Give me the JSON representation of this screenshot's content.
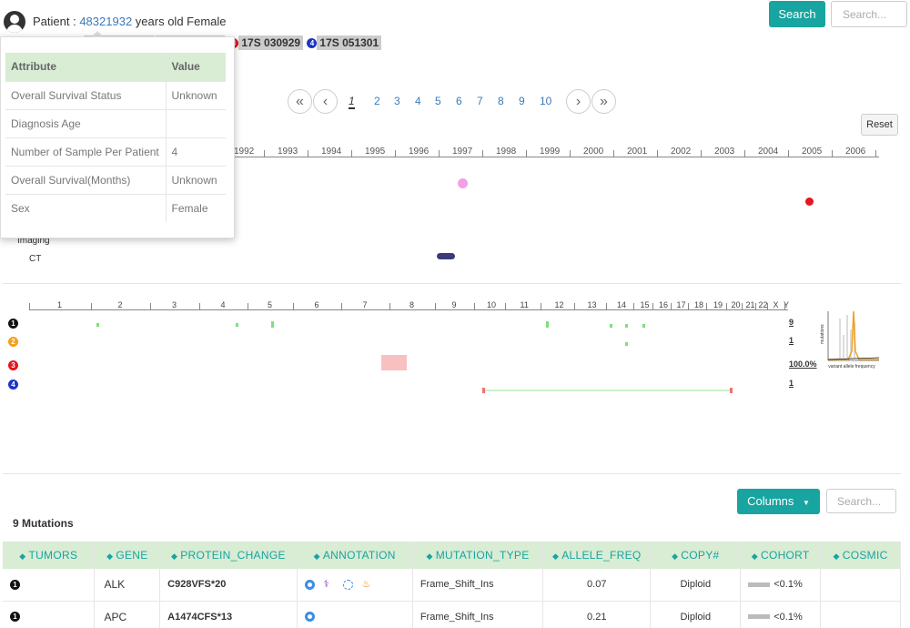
{
  "header": {
    "patient_label": "Patient :",
    "patient_id": "48321932",
    "patient_desc": "years old Female",
    "sample_3": "17S 030929",
    "sample_4": "17S 051301",
    "badge_3": "3",
    "badge_4": "4",
    "search_button": "Search",
    "search_placeholder": "Search..."
  },
  "popover": {
    "header_attr": "Attribute",
    "header_value": "Value",
    "rows": [
      {
        "attr": "Overall Survival Status",
        "value": "Unknown"
      },
      {
        "attr": "Diagnosis Age",
        "value": ""
      },
      {
        "attr": "Number of Sample Per Patient",
        "value": "4"
      },
      {
        "attr": "Overall Survival(Months)",
        "value": "Unknown"
      },
      {
        "attr": "Sex",
        "value": "Female"
      }
    ]
  },
  "pagination": {
    "first": "«",
    "prev": "‹",
    "next": "›",
    "last": "»",
    "pages": [
      "1",
      "2",
      "3",
      "4",
      "5",
      "6",
      "7",
      "8",
      "9",
      "10"
    ],
    "current": "1"
  },
  "timeline": {
    "reset_label": "Reset",
    "years": [
      "1992",
      "1993",
      "1994",
      "1995",
      "1996",
      "1997",
      "1998",
      "1999",
      "2000",
      "2001",
      "2002",
      "2003",
      "2004",
      "2005",
      "2006"
    ],
    "track_imaging": "Imaging",
    "track_ct": "CT",
    "colors": {
      "pink": "#f2a0e8",
      "red": "#e8141e",
      "navy": "#3b3a7a"
    }
  },
  "genome": {
    "chromosomes": [
      "1",
      "2",
      "3",
      "4",
      "5",
      "6",
      "7",
      "8",
      "9",
      "10",
      "11",
      "12",
      "13",
      "14",
      "15",
      "16",
      "17",
      "18",
      "19",
      "20",
      "21",
      "22",
      "X",
      "Y"
    ],
    "rows": [
      {
        "badge": "1",
        "color": "#111111",
        "side": "9"
      },
      {
        "badge": "2",
        "color": "#f2a11c",
        "side": "1"
      },
      {
        "badge": "3",
        "color": "#e8141e",
        "side": "100.0%"
      },
      {
        "badge": "4",
        "color": "#1b35c8",
        "side": "1"
      }
    ],
    "vaf_label": "variant allele frequency",
    "mutations_axis_label": "mutations"
  },
  "mutations": {
    "count_label": "9 Mutations",
    "columns_button": "Columns",
    "search_placeholder": "Search...",
    "headers": [
      "TUMORS",
      "GENE",
      "PROTEIN_CHANGE",
      "ANNOTATION",
      "MUTATION_TYPE",
      "ALLELE_FREQ",
      "COPY#",
      "COHORT",
      "COSMIC"
    ],
    "rows": [
      {
        "tumor": "1",
        "gene": "ALK",
        "protein": "C928VFS*20",
        "type": "Frame_Shift_Ins",
        "freq": "0.07",
        "copy": "Diploid",
        "cohort": "<0.1%",
        "cosmic": ""
      },
      {
        "tumor": "1",
        "gene": "APC",
        "protein": "A1474CFS*13",
        "type": "Frame_Shift_Ins",
        "freq": "0.21",
        "copy": "Diploid",
        "cohort": "<0.1%",
        "cosmic": ""
      }
    ]
  }
}
